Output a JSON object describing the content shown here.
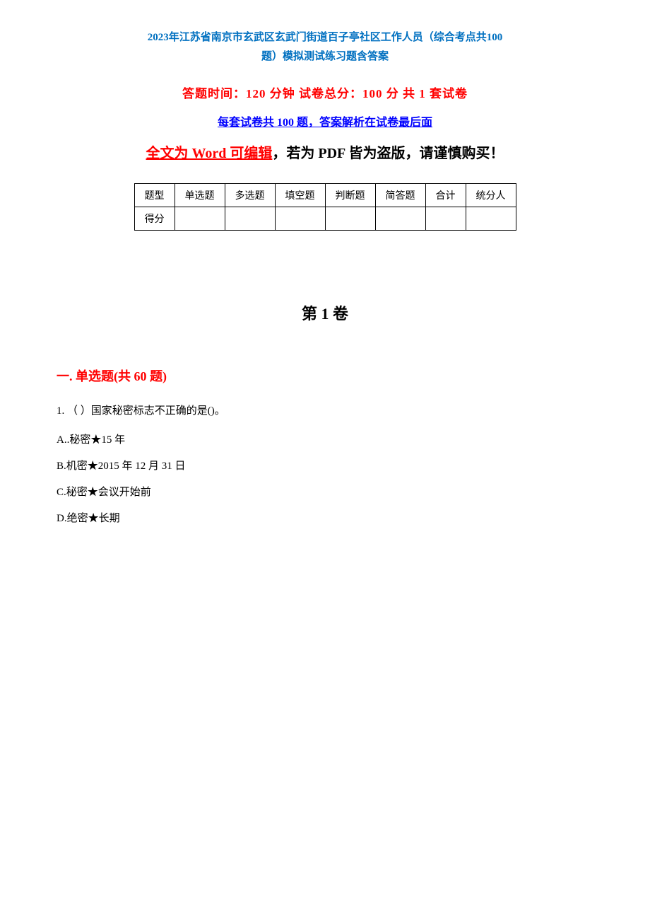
{
  "page": {
    "title_line1": "2023年江苏省南京市玄武区玄武门街道百子亭社区工作人员（综合考点共100",
    "title_line2": "题）模拟测试练习题含答案",
    "exam_info": "答题时间：120 分钟      试卷总分：100 分      共 1 套试卷",
    "subtitle": "每套试卷共 100 题，答案解析在试卷最后面",
    "editable_notice_red": "全文为 Word 可编辑",
    "editable_notice_black": "，若为 PDF 皆为盗版，请谨慎购买！",
    "table": {
      "headers": [
        "题型",
        "单选题",
        "多选题",
        "填空题",
        "判断题",
        "简答题",
        "合计",
        "统分人"
      ],
      "score_label": "得分"
    },
    "volume_title": "第 1 卷",
    "section_title": "一. 单选题(共 60 题)",
    "questions": [
      {
        "number": "1.",
        "text": "（ ）国家秘密标志不正确的是()。",
        "options": [
          "A..秘密★15 年",
          "B.机密★2015 年 12 月 31 日",
          "C.秘密★会议开始前",
          "D.绝密★长期"
        ]
      }
    ]
  }
}
